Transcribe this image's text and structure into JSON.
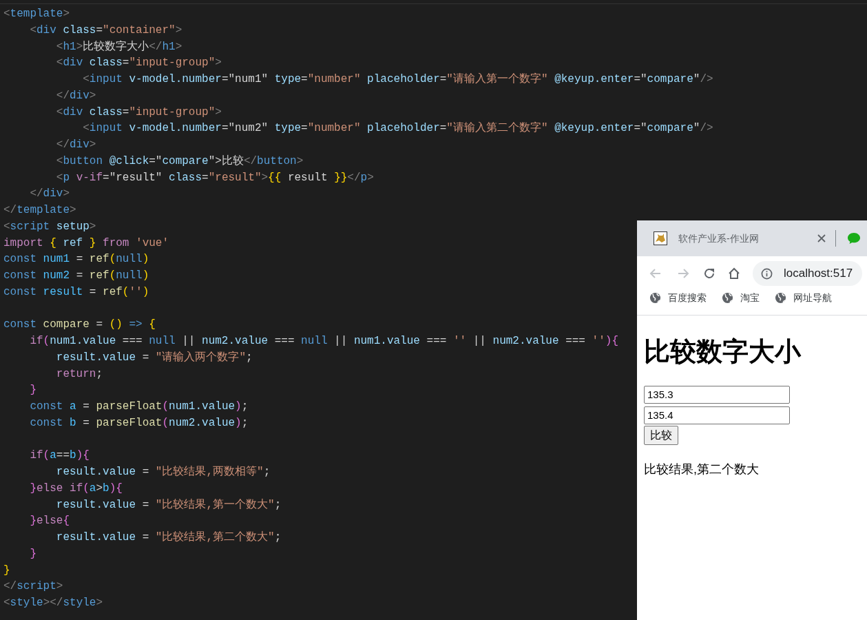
{
  "editor": {
    "lines": [
      [
        {
          "text": "<",
          "kind": "punct"
        },
        {
          "text": "template",
          "kind": "tag"
        },
        {
          "text": ">",
          "kind": "punct"
        }
      ],
      [
        {
          "text": "    <",
          "kind": "punct"
        },
        {
          "text": "div",
          "kind": "tag"
        },
        {
          "text": " class",
          "kind": "attr"
        },
        {
          "text": "=",
          "kind": "plain"
        },
        {
          "text": "\"container\"",
          "kind": "str"
        },
        {
          "text": ">",
          "kind": "punct"
        }
      ],
      [
        {
          "text": "        <",
          "kind": "punct"
        },
        {
          "text": "h1",
          "kind": "tag"
        },
        {
          "text": ">",
          "kind": "punct"
        },
        {
          "text": "比较数字大小",
          "kind": "plain"
        },
        {
          "text": "</",
          "kind": "punct"
        },
        {
          "text": "h1",
          "kind": "tag"
        },
        {
          "text": ">",
          "kind": "punct"
        }
      ],
      [
        {
          "text": "        <",
          "kind": "punct"
        },
        {
          "text": "div",
          "kind": "tag"
        },
        {
          "text": " class",
          "kind": "attr"
        },
        {
          "text": "=",
          "kind": "plain"
        },
        {
          "text": "\"input-group\"",
          "kind": "str"
        },
        {
          "text": ">",
          "kind": "punct"
        }
      ],
      [
        {
          "text": "            <",
          "kind": "punct"
        },
        {
          "text": "input",
          "kind": "tag"
        },
        {
          "text": " v-model.number",
          "kind": "attr"
        },
        {
          "text": "=\"num1\" ",
          "kind": "plain"
        },
        {
          "text": "type",
          "kind": "attr"
        },
        {
          "text": "=",
          "kind": "plain"
        },
        {
          "text": "\"number\"",
          "kind": "str"
        },
        {
          "text": " placeholder",
          "kind": "attr"
        },
        {
          "text": "=",
          "kind": "plain"
        },
        {
          "text": "\"请输入第一个数字\"",
          "kind": "str"
        },
        {
          "text": " @keyup.enter",
          "kind": "attr"
        },
        {
          "text": "=\"",
          "kind": "plain"
        },
        {
          "text": "compare",
          "kind": "var"
        },
        {
          "text": "\"",
          "kind": "plain"
        },
        {
          "text": "/>",
          "kind": "punct"
        }
      ],
      [
        {
          "text": "        </",
          "kind": "punct"
        },
        {
          "text": "div",
          "kind": "tag"
        },
        {
          "text": ">",
          "kind": "punct"
        }
      ],
      [
        {
          "text": "        <",
          "kind": "punct"
        },
        {
          "text": "div",
          "kind": "tag"
        },
        {
          "text": " class",
          "kind": "attr"
        },
        {
          "text": "=",
          "kind": "plain"
        },
        {
          "text": "\"input-group\"",
          "kind": "str"
        },
        {
          "text": ">",
          "kind": "punct"
        }
      ],
      [
        {
          "text": "            <",
          "kind": "punct"
        },
        {
          "text": "input",
          "kind": "tag"
        },
        {
          "text": " v-model.number",
          "kind": "attr"
        },
        {
          "text": "=\"num2\" ",
          "kind": "plain"
        },
        {
          "text": "type",
          "kind": "attr"
        },
        {
          "text": "=",
          "kind": "plain"
        },
        {
          "text": "\"number\"",
          "kind": "str"
        },
        {
          "text": " placeholder",
          "kind": "attr"
        },
        {
          "text": "=",
          "kind": "plain"
        },
        {
          "text": "\"请输入第二个数字\"",
          "kind": "str"
        },
        {
          "text": " @keyup.enter",
          "kind": "attr"
        },
        {
          "text": "=\"",
          "kind": "plain"
        },
        {
          "text": "compare",
          "kind": "var"
        },
        {
          "text": "\"",
          "kind": "plain"
        },
        {
          "text": "/>",
          "kind": "punct"
        }
      ],
      [
        {
          "text": "        </",
          "kind": "punct"
        },
        {
          "text": "div",
          "kind": "tag"
        },
        {
          "text": ">",
          "kind": "punct"
        }
      ],
      [
        {
          "text": "        <",
          "kind": "punct"
        },
        {
          "text": "button",
          "kind": "tag"
        },
        {
          "text": " @click",
          "kind": "attr"
        },
        {
          "text": "=\"",
          "kind": "plain"
        },
        {
          "text": "compare",
          "kind": "var"
        },
        {
          "text": "\">",
          "kind": "plain"
        },
        {
          "text": "比较",
          "kind": "plain"
        },
        {
          "text": "</",
          "kind": "punct"
        },
        {
          "text": "button",
          "kind": "tag"
        },
        {
          "text": ">",
          "kind": "punct"
        }
      ],
      [
        {
          "text": "        <",
          "kind": "punct"
        },
        {
          "text": "p",
          "kind": "tag"
        },
        {
          "text": " v-if",
          "kind": "ctrl"
        },
        {
          "text": "=\"result\" ",
          "kind": "plain"
        },
        {
          "text": "class",
          "kind": "attr"
        },
        {
          "text": "=",
          "kind": "plain"
        },
        {
          "text": "\"result\"",
          "kind": "str"
        },
        {
          "text": ">",
          "kind": "punct"
        },
        {
          "text": "{{",
          "kind": "brace1"
        },
        {
          "text": " result ",
          "kind": "plain"
        },
        {
          "text": "}}",
          "kind": "brace1"
        },
        {
          "text": "</",
          "kind": "punct"
        },
        {
          "text": "p",
          "kind": "tag"
        },
        {
          "text": ">",
          "kind": "punct"
        }
      ],
      [
        {
          "text": "    </",
          "kind": "punct"
        },
        {
          "text": "div",
          "kind": "tag"
        },
        {
          "text": ">",
          "kind": "punct"
        }
      ],
      [
        {
          "text": "</",
          "kind": "punct"
        },
        {
          "text": "template",
          "kind": "tag"
        },
        {
          "text": ">",
          "kind": "punct"
        }
      ],
      [
        {
          "text": "<",
          "kind": "punct"
        },
        {
          "text": "script",
          "kind": "tag"
        },
        {
          "text": " setup",
          "kind": "attr"
        },
        {
          "text": ">",
          "kind": "punct"
        }
      ],
      [
        {
          "text": "import",
          "kind": "ctrl"
        },
        {
          "text": " {",
          "kind": "brace1"
        },
        {
          "text": " ref ",
          "kind": "var"
        },
        {
          "text": "}",
          "kind": "brace1"
        },
        {
          "text": " from",
          "kind": "ctrl"
        },
        {
          "text": " 'vue'",
          "kind": "str"
        }
      ],
      [
        {
          "text": "const",
          "kind": "kw"
        },
        {
          "text": " num1",
          "kind": "const"
        },
        {
          "text": " = ",
          "kind": "plain"
        },
        {
          "text": "ref",
          "kind": "fn"
        },
        {
          "text": "(",
          "kind": "brace1"
        },
        {
          "text": "null",
          "kind": "kw"
        },
        {
          "text": ")",
          "kind": "brace1"
        }
      ],
      [
        {
          "text": "const",
          "kind": "kw"
        },
        {
          "text": " num2",
          "kind": "const"
        },
        {
          "text": " = ",
          "kind": "plain"
        },
        {
          "text": "ref",
          "kind": "fn"
        },
        {
          "text": "(",
          "kind": "brace1"
        },
        {
          "text": "null",
          "kind": "kw"
        },
        {
          "text": ")",
          "kind": "brace1"
        }
      ],
      [
        {
          "text": "const",
          "kind": "kw"
        },
        {
          "text": " result",
          "kind": "const"
        },
        {
          "text": " = ",
          "kind": "plain"
        },
        {
          "text": "ref",
          "kind": "fn"
        },
        {
          "text": "(",
          "kind": "brace1"
        },
        {
          "text": "''",
          "kind": "str"
        },
        {
          "text": ")",
          "kind": "brace1"
        }
      ],
      {
        "kind": "blank"
      },
      [
        {
          "text": "const",
          "kind": "kw"
        },
        {
          "text": " compare",
          "kind": "fn"
        },
        {
          "text": " = ",
          "kind": "plain"
        },
        {
          "text": "()",
          "kind": "brace1"
        },
        {
          "text": " => ",
          "kind": "kw"
        },
        {
          "text": "{",
          "kind": "brace1"
        }
      ],
      [
        {
          "text": "    if",
          "kind": "ctrl"
        },
        {
          "text": "(",
          "kind": "brace2"
        },
        {
          "text": "num1.value",
          "kind": "var"
        },
        {
          "text": " === ",
          "kind": "plain"
        },
        {
          "text": "null",
          "kind": "kw"
        },
        {
          "text": " || ",
          "kind": "plain"
        },
        {
          "text": "num2.value",
          "kind": "var"
        },
        {
          "text": " === ",
          "kind": "plain"
        },
        {
          "text": "null",
          "kind": "kw"
        },
        {
          "text": " || ",
          "kind": "plain"
        },
        {
          "text": "num1.value",
          "kind": "var"
        },
        {
          "text": " === ",
          "kind": "plain"
        },
        {
          "text": "''",
          "kind": "str"
        },
        {
          "text": " || ",
          "kind": "plain"
        },
        {
          "text": "num2.value",
          "kind": "var"
        },
        {
          "text": " === ",
          "kind": "plain"
        },
        {
          "text": "''",
          "kind": "str"
        },
        {
          "text": ")",
          "kind": "brace2"
        },
        {
          "text": "{",
          "kind": "brace2"
        }
      ],
      [
        {
          "text": "        result.value",
          "kind": "var"
        },
        {
          "text": " = ",
          "kind": "plain"
        },
        {
          "text": "\"请输入两个数字\"",
          "kind": "str"
        },
        {
          "text": ";",
          "kind": "plain"
        }
      ],
      [
        {
          "text": "        return",
          "kind": "ctrl"
        },
        {
          "text": ";",
          "kind": "plain"
        }
      ],
      [
        {
          "text": "    }",
          "kind": "brace2"
        }
      ],
      [
        {
          "text": "    const",
          "kind": "kw"
        },
        {
          "text": " a",
          "kind": "const"
        },
        {
          "text": " = ",
          "kind": "plain"
        },
        {
          "text": "parseFloat",
          "kind": "fn"
        },
        {
          "text": "(",
          "kind": "brace2"
        },
        {
          "text": "num1.value",
          "kind": "var"
        },
        {
          "text": ")",
          "kind": "brace2"
        },
        {
          "text": ";",
          "kind": "plain"
        }
      ],
      [
        {
          "text": "    const",
          "kind": "kw"
        },
        {
          "text": " b",
          "kind": "const"
        },
        {
          "text": " = ",
          "kind": "plain"
        },
        {
          "text": "parseFloat",
          "kind": "fn"
        },
        {
          "text": "(",
          "kind": "brace2"
        },
        {
          "text": "num2.value",
          "kind": "var"
        },
        {
          "text": ")",
          "kind": "brace2"
        },
        {
          "text": ";",
          "kind": "plain"
        }
      ],
      {
        "kind": "blank"
      },
      [
        {
          "text": "    if",
          "kind": "ctrl"
        },
        {
          "text": "(",
          "kind": "brace2"
        },
        {
          "text": "a",
          "kind": "const"
        },
        {
          "text": "==",
          "kind": "plain"
        },
        {
          "text": "b",
          "kind": "const"
        },
        {
          "text": ")",
          "kind": "brace2"
        },
        {
          "text": "{",
          "kind": "brace2"
        }
      ],
      [
        {
          "text": "        result.value",
          "kind": "var"
        },
        {
          "text": " = ",
          "kind": "plain"
        },
        {
          "text": "\"比较结果,两数相等\"",
          "kind": "str"
        },
        {
          "text": ";",
          "kind": "plain"
        }
      ],
      [
        {
          "text": "    }",
          "kind": "brace2"
        },
        {
          "text": "else if",
          "kind": "ctrl"
        },
        {
          "text": "(",
          "kind": "brace2"
        },
        {
          "text": "a",
          "kind": "const"
        },
        {
          "text": ">",
          "kind": "plain"
        },
        {
          "text": "b",
          "kind": "const"
        },
        {
          "text": ")",
          "kind": "brace2"
        },
        {
          "text": "{",
          "kind": "brace2"
        }
      ],
      [
        {
          "text": "        result.value",
          "kind": "var"
        },
        {
          "text": " = ",
          "kind": "plain"
        },
        {
          "text": "\"比较结果,第一个数大\"",
          "kind": "str"
        },
        {
          "text": ";",
          "kind": "plain"
        }
      ],
      [
        {
          "text": "    }",
          "kind": "brace2"
        },
        {
          "text": "else",
          "kind": "ctrl"
        },
        {
          "text": "{",
          "kind": "brace2"
        }
      ],
      [
        {
          "text": "        result.value",
          "kind": "var"
        },
        {
          "text": " = ",
          "kind": "plain"
        },
        {
          "text": "\"比较结果,第二个数大\"",
          "kind": "str"
        },
        {
          "text": ";",
          "kind": "plain"
        }
      ],
      [
        {
          "text": "    }",
          "kind": "brace2"
        }
      ],
      [
        {
          "text": "}",
          "kind": "brace1"
        }
      ],
      [
        {
          "text": "</",
          "kind": "punct"
        },
        {
          "text": "script",
          "kind": "tag"
        },
        {
          "text": ">",
          "kind": "punct"
        }
      ],
      [
        {
          "text": "<",
          "kind": "punct"
        },
        {
          "text": "style",
          "kind": "tag"
        },
        {
          "text": "></",
          "kind": "punct"
        },
        {
          "text": "style",
          "kind": "tag"
        },
        {
          "text": ">",
          "kind": "punct"
        }
      ]
    ]
  },
  "browser": {
    "tab": {
      "title": "软件产业系-作业网"
    },
    "nav": {
      "back": {
        "disabled": true
      },
      "forward": {
        "disabled": true
      }
    },
    "address": "localhost:517",
    "bookmarks": [
      {
        "label": "百度搜索"
      },
      {
        "label": "淘宝"
      },
      {
        "label": "网址导航"
      }
    ],
    "page": {
      "heading": "比较数字大小",
      "inputs": [
        {
          "value": "135.3"
        },
        {
          "value": "135.4"
        }
      ],
      "button": "比较",
      "result": "比较结果,第二个数大"
    }
  }
}
